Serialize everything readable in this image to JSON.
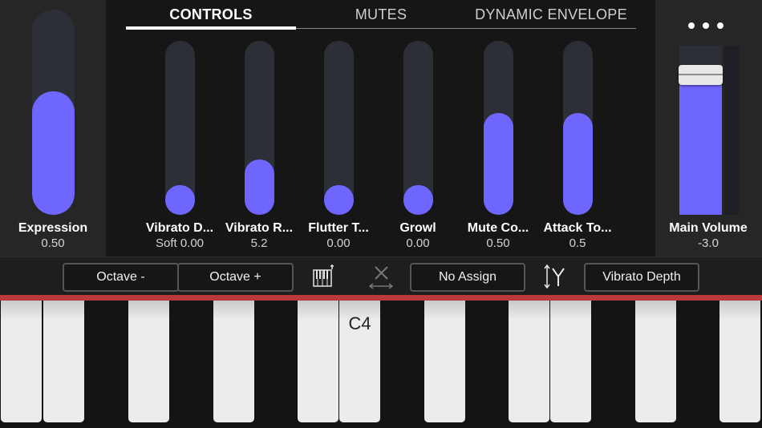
{
  "tabs": [
    {
      "label": "CONTROLS",
      "active": true
    },
    {
      "label": "MUTES",
      "active": false
    },
    {
      "label": "DYNAMIC ENVELOPE",
      "active": false
    }
  ],
  "expression": {
    "label": "Expression",
    "value": "0.50",
    "level": 0.5
  },
  "knobs": [
    {
      "label": "Vibrato D...",
      "value": "Soft 0.00",
      "level": 0.0
    },
    {
      "label": "Vibrato R...",
      "value": "5.2",
      "level": 0.18
    },
    {
      "label": "Flutter T...",
      "value": "0.00",
      "level": 0.0
    },
    {
      "label": "Growl",
      "value": "0.00",
      "level": 0.0
    },
    {
      "label": "Mute Co...",
      "value": "0.50",
      "level": 0.5
    },
    {
      "label": "Attack To...",
      "value": "0.5",
      "level": 0.5
    }
  ],
  "main_volume": {
    "label": "Main Volume",
    "value": "-3.0",
    "level": 0.83
  },
  "more_icon": "more-horizontal-icon",
  "toolbar": {
    "octave_down": "Octave -",
    "octave_up": "Octave +",
    "keyboard_icon": "keyboard-icon",
    "assign_clear_icon": "clear-assign-icon",
    "x_assign": "No Assign",
    "y_axis_icon": "y-axis-icon",
    "y_assign": "Vibrato Depth"
  },
  "keyboard": {
    "label": "C4",
    "accent_color": "#b83a3a"
  },
  "colors": {
    "slider_fill": "#6f66ff",
    "track": "#2d2f36"
  }
}
